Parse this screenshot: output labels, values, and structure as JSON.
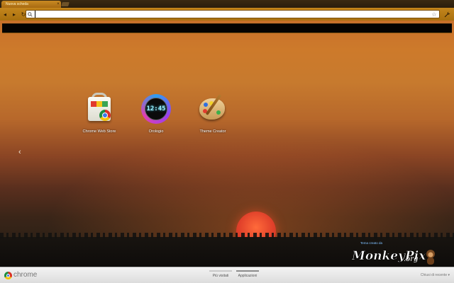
{
  "tab": {
    "title": "Nuova scheda",
    "close_glyph": "×"
  },
  "toolbar": {
    "back_glyph": "◂",
    "forward_glyph": "▸",
    "reload_glyph": "↻",
    "omnibox_value": "",
    "wrench_glyph": "🔧",
    "star_glyph": "☆"
  },
  "apps": [
    {
      "label": "Chrome Web Store",
      "icon": "webstore-icon"
    },
    {
      "label": "Orologio",
      "icon": "clock-icon",
      "clock_digits": "12:45"
    },
    {
      "label": "Theme Creator",
      "icon": "palette-icon"
    }
  ],
  "nav": {
    "prev_glyph": "‹"
  },
  "credit": {
    "small": "Tema creato da",
    "brand": "MonkeyPix",
    "brand_suffix": ".org"
  },
  "bottombar": {
    "brand": "chrome",
    "pages": [
      {
        "label": "Più visitati",
        "active": false
      },
      {
        "label": "Applicazioni",
        "active": true
      }
    ],
    "recent": "Chiusi di recente ▾"
  },
  "colors": {
    "toolbar": "#c4861c",
    "sun": "#e0402a",
    "sky_top": "#c8702a",
    "credit_link": "#7fc0ff"
  }
}
